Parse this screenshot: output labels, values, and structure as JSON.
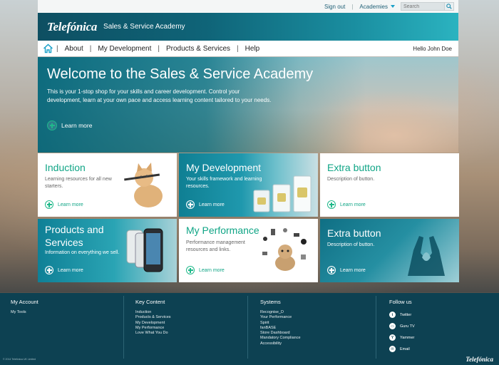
{
  "util": {
    "sign_out": "Sign out",
    "academies": "Academies",
    "search_placeholder": "Search"
  },
  "brand": {
    "logo": "Telefónica",
    "title": "Sales & Service Academy"
  },
  "nav": {
    "items": [
      "About",
      "My Development",
      "Products & Services",
      "Help"
    ],
    "greeting": "Hello John Doe"
  },
  "hero": {
    "title": "Welcome to the Sales & Service Academy",
    "text": "This is your 1-stop shop for your skills and career development. Control your development, learn at your own pace and access learning content tailored to your needs.",
    "learn_more": "Learn more"
  },
  "tiles": [
    {
      "title": "Induction",
      "desc": "Learning resources for all new starters.",
      "learn_more": "Learn more"
    },
    {
      "title": "My Development",
      "desc": "Your skills framework and learning resources.",
      "learn_more": "Learn more"
    },
    {
      "title": "Extra button",
      "desc": "Description of button.",
      "learn_more": "Learn more"
    },
    {
      "title": "Products and Services",
      "desc": "Information on everything we sell.",
      "learn_more": "Learn more"
    },
    {
      "title": "My Performance",
      "desc": "Performance management resources and links.",
      "learn_more": "Learn more"
    },
    {
      "title": "Extra button",
      "desc": "Description of button.",
      "learn_more": "Learn more"
    }
  ],
  "footer": {
    "my_account": {
      "heading": "My Account",
      "links": [
        "My Tools"
      ]
    },
    "key_content": {
      "heading": "Key Content",
      "links": [
        "Induction",
        "Products & Services",
        "My Development",
        "My Performance",
        "Love What You Do"
      ]
    },
    "systems": {
      "heading": "Systems",
      "links": [
        "Recognise_D",
        "Your Performance",
        "Spirit",
        "fanBASE",
        "Store Dashboard",
        "Mandatory Compliance",
        "Accessibility"
      ]
    },
    "follow_us": {
      "heading": "Follow us",
      "links": [
        "Twitter",
        "Guru TV",
        "Yammer",
        "Email"
      ]
    },
    "copyright": "© 2014 Telefónica UK Limited",
    "logo": "Telefónica"
  },
  "colors": {
    "brand_teal": "#0f6478",
    "accent_green": "#10a586",
    "footer_bg": "#0d4152"
  },
  "icons": {
    "home": "home-icon",
    "search": "search-icon",
    "plus": "plus-circle-icon",
    "twitter": "twitter-icon",
    "guru_tv": "tv-icon",
    "yammer": "yammer-icon",
    "email": "email-icon"
  }
}
